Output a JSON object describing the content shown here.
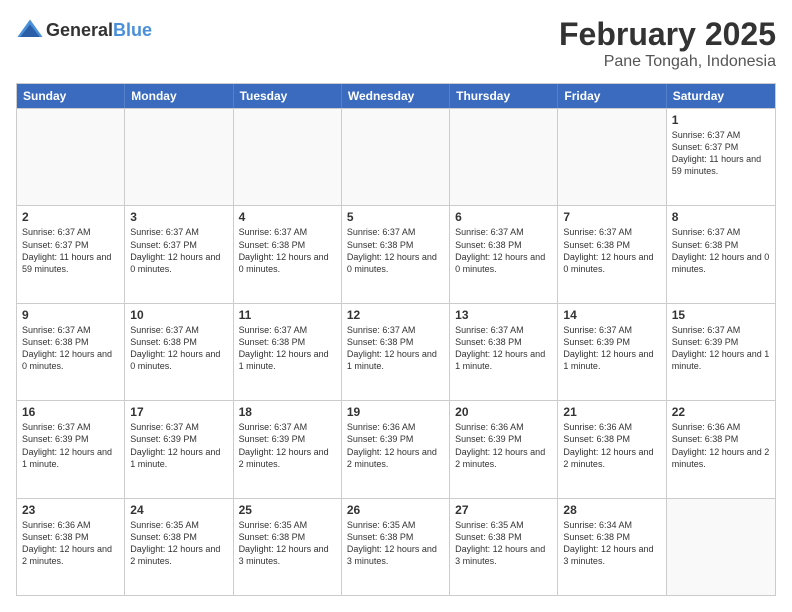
{
  "header": {
    "logo": {
      "text_general": "General",
      "text_blue": "Blue"
    },
    "month_title": "February 2025",
    "location": "Pane Tongah, Indonesia"
  },
  "calendar": {
    "days_of_week": [
      "Sunday",
      "Monday",
      "Tuesday",
      "Wednesday",
      "Thursday",
      "Friday",
      "Saturday"
    ],
    "rows": [
      [
        {
          "day": "",
          "info": ""
        },
        {
          "day": "",
          "info": ""
        },
        {
          "day": "",
          "info": ""
        },
        {
          "day": "",
          "info": ""
        },
        {
          "day": "",
          "info": ""
        },
        {
          "day": "",
          "info": ""
        },
        {
          "day": "1",
          "info": "Sunrise: 6:37 AM\nSunset: 6:37 PM\nDaylight: 11 hours and 59 minutes."
        }
      ],
      [
        {
          "day": "2",
          "info": "Sunrise: 6:37 AM\nSunset: 6:37 PM\nDaylight: 11 hours and 59 minutes."
        },
        {
          "day": "3",
          "info": "Sunrise: 6:37 AM\nSunset: 6:37 PM\nDaylight: 12 hours and 0 minutes."
        },
        {
          "day": "4",
          "info": "Sunrise: 6:37 AM\nSunset: 6:38 PM\nDaylight: 12 hours and 0 minutes."
        },
        {
          "day": "5",
          "info": "Sunrise: 6:37 AM\nSunset: 6:38 PM\nDaylight: 12 hours and 0 minutes."
        },
        {
          "day": "6",
          "info": "Sunrise: 6:37 AM\nSunset: 6:38 PM\nDaylight: 12 hours and 0 minutes."
        },
        {
          "day": "7",
          "info": "Sunrise: 6:37 AM\nSunset: 6:38 PM\nDaylight: 12 hours and 0 minutes."
        },
        {
          "day": "8",
          "info": "Sunrise: 6:37 AM\nSunset: 6:38 PM\nDaylight: 12 hours and 0 minutes."
        }
      ],
      [
        {
          "day": "9",
          "info": "Sunrise: 6:37 AM\nSunset: 6:38 PM\nDaylight: 12 hours and 0 minutes."
        },
        {
          "day": "10",
          "info": "Sunrise: 6:37 AM\nSunset: 6:38 PM\nDaylight: 12 hours and 0 minutes."
        },
        {
          "day": "11",
          "info": "Sunrise: 6:37 AM\nSunset: 6:38 PM\nDaylight: 12 hours and 1 minute."
        },
        {
          "day": "12",
          "info": "Sunrise: 6:37 AM\nSunset: 6:38 PM\nDaylight: 12 hours and 1 minute."
        },
        {
          "day": "13",
          "info": "Sunrise: 6:37 AM\nSunset: 6:38 PM\nDaylight: 12 hours and 1 minute."
        },
        {
          "day": "14",
          "info": "Sunrise: 6:37 AM\nSunset: 6:39 PM\nDaylight: 12 hours and 1 minute."
        },
        {
          "day": "15",
          "info": "Sunrise: 6:37 AM\nSunset: 6:39 PM\nDaylight: 12 hours and 1 minute."
        }
      ],
      [
        {
          "day": "16",
          "info": "Sunrise: 6:37 AM\nSunset: 6:39 PM\nDaylight: 12 hours and 1 minute."
        },
        {
          "day": "17",
          "info": "Sunrise: 6:37 AM\nSunset: 6:39 PM\nDaylight: 12 hours and 1 minute."
        },
        {
          "day": "18",
          "info": "Sunrise: 6:37 AM\nSunset: 6:39 PM\nDaylight: 12 hours and 2 minutes."
        },
        {
          "day": "19",
          "info": "Sunrise: 6:36 AM\nSunset: 6:39 PM\nDaylight: 12 hours and 2 minutes."
        },
        {
          "day": "20",
          "info": "Sunrise: 6:36 AM\nSunset: 6:39 PM\nDaylight: 12 hours and 2 minutes."
        },
        {
          "day": "21",
          "info": "Sunrise: 6:36 AM\nSunset: 6:38 PM\nDaylight: 12 hours and 2 minutes."
        },
        {
          "day": "22",
          "info": "Sunrise: 6:36 AM\nSunset: 6:38 PM\nDaylight: 12 hours and 2 minutes."
        }
      ],
      [
        {
          "day": "23",
          "info": "Sunrise: 6:36 AM\nSunset: 6:38 PM\nDaylight: 12 hours and 2 minutes."
        },
        {
          "day": "24",
          "info": "Sunrise: 6:35 AM\nSunset: 6:38 PM\nDaylight: 12 hours and 2 minutes."
        },
        {
          "day": "25",
          "info": "Sunrise: 6:35 AM\nSunset: 6:38 PM\nDaylight: 12 hours and 3 minutes."
        },
        {
          "day": "26",
          "info": "Sunrise: 6:35 AM\nSunset: 6:38 PM\nDaylight: 12 hours and 3 minutes."
        },
        {
          "day": "27",
          "info": "Sunrise: 6:35 AM\nSunset: 6:38 PM\nDaylight: 12 hours and 3 minutes."
        },
        {
          "day": "28",
          "info": "Sunrise: 6:34 AM\nSunset: 6:38 PM\nDaylight: 12 hours and 3 minutes."
        },
        {
          "day": "",
          "info": ""
        }
      ]
    ]
  }
}
